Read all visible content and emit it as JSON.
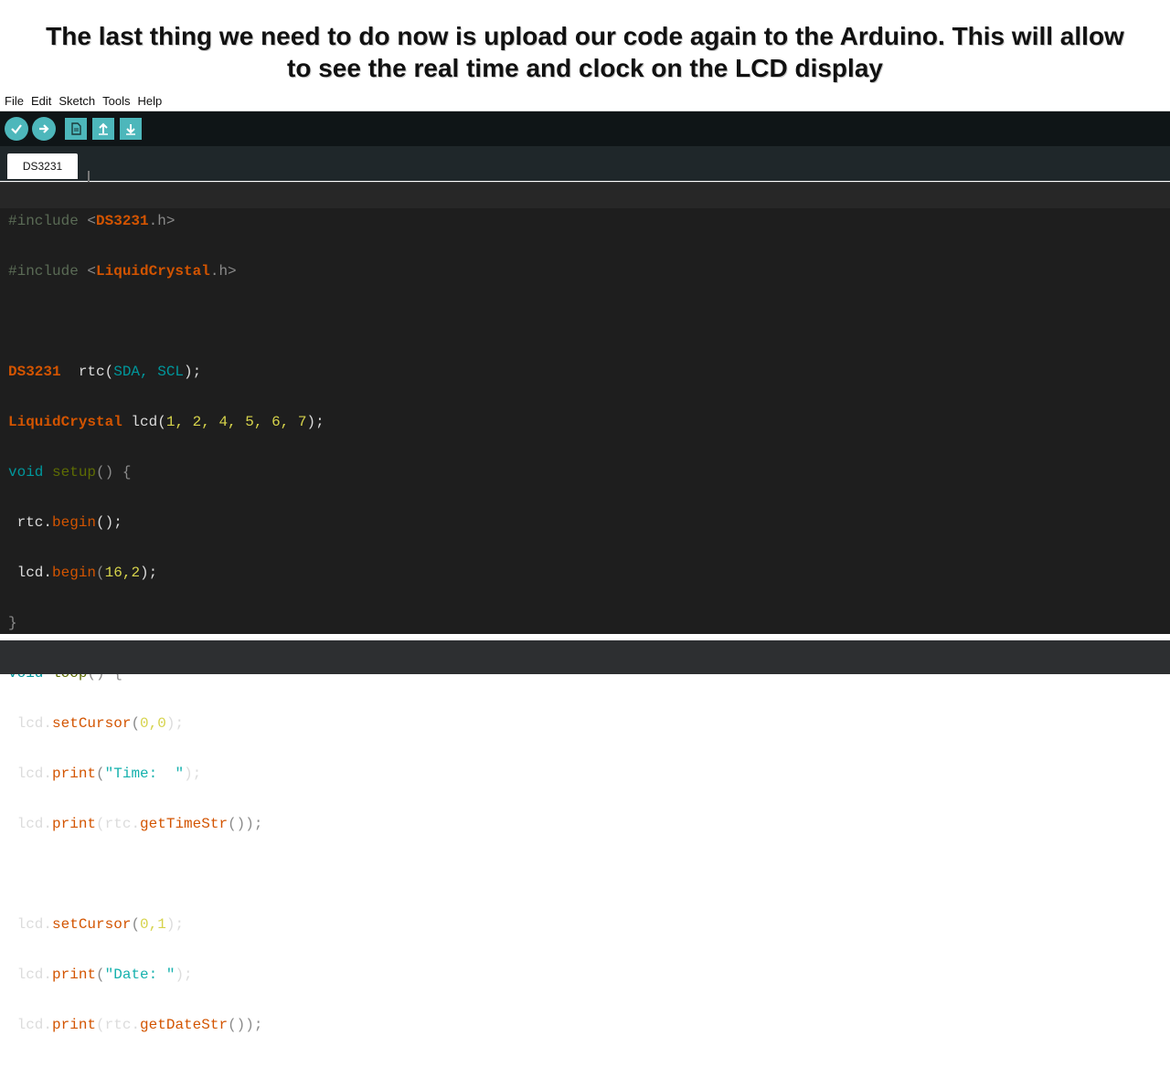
{
  "caption": {
    "line1": "The last thing we need to do now is upload our code again to the Arduino. This will allow",
    "line2": "to see the real time and clock on the LCD display"
  },
  "menu": [
    "File",
    "Edit",
    "Sketch",
    "Tools",
    "Help"
  ],
  "toolbar": {
    "verify_icon": "check-icon",
    "upload_icon": "arrow-right-icon",
    "new_icon": "new-file-icon",
    "open_icon": "arrow-up-icon",
    "save_icon": "arrow-down-icon"
  },
  "tab": {
    "label": "DS3231"
  },
  "code": {
    "l1": {
      "a": "#include",
      "b": " <",
      "c": "DS3231",
      "d": ".h>"
    },
    "l2": {
      "a": "#include",
      "b": " <",
      "c": "LiquidCrystal",
      "d": ".h>"
    },
    "l4": {
      "a": "DS3231",
      "b": "  rtc(",
      "c": "SDA, SCL",
      "d": ");"
    },
    "l5": {
      "a": "LiquidCrystal",
      "b": " lcd(",
      "c": "1, 2, 4, 5, 6, 7",
      "d": ");"
    },
    "l6": {
      "a": "void",
      "b": " ",
      "c": "setup",
      "d": "() {"
    },
    "l7": {
      "a": " rtc.",
      "b": "begin",
      "c": "();"
    },
    "l8": {
      "a": " lcd.",
      "b": "begin",
      "c": "(",
      "d": "16,2",
      "e": ");"
    },
    "l9": {
      "a": "}"
    },
    "l10": {
      "a": "void",
      "b": " ",
      "c": "loop",
      "d": "() {"
    },
    "l11": {
      "a": " lcd.",
      "b": "setCursor",
      "c": "(",
      "d": "0,0",
      "e": ");"
    },
    "l12": {
      "a": " lcd.",
      "b": "print",
      "c": "(",
      "d": "\"Time:  \"",
      "e": ");"
    },
    "l13": {
      "a": " lcd.",
      "b": "print",
      "c": "(rtc.",
      "d": "getTimeStr",
      "e": "());"
    },
    "l15": {
      "a": " lcd.",
      "b": "setCursor",
      "c": "(",
      "d": "0,1",
      "e": ");"
    },
    "l16": {
      "a": " lcd.",
      "b": "print",
      "c": "(",
      "d": "\"Date: \"",
      "e": ");"
    },
    "l17": {
      "a": " lcd.",
      "b": "print",
      "c": "(rtc.",
      "d": "getDateStr",
      "e": "());"
    }
  }
}
